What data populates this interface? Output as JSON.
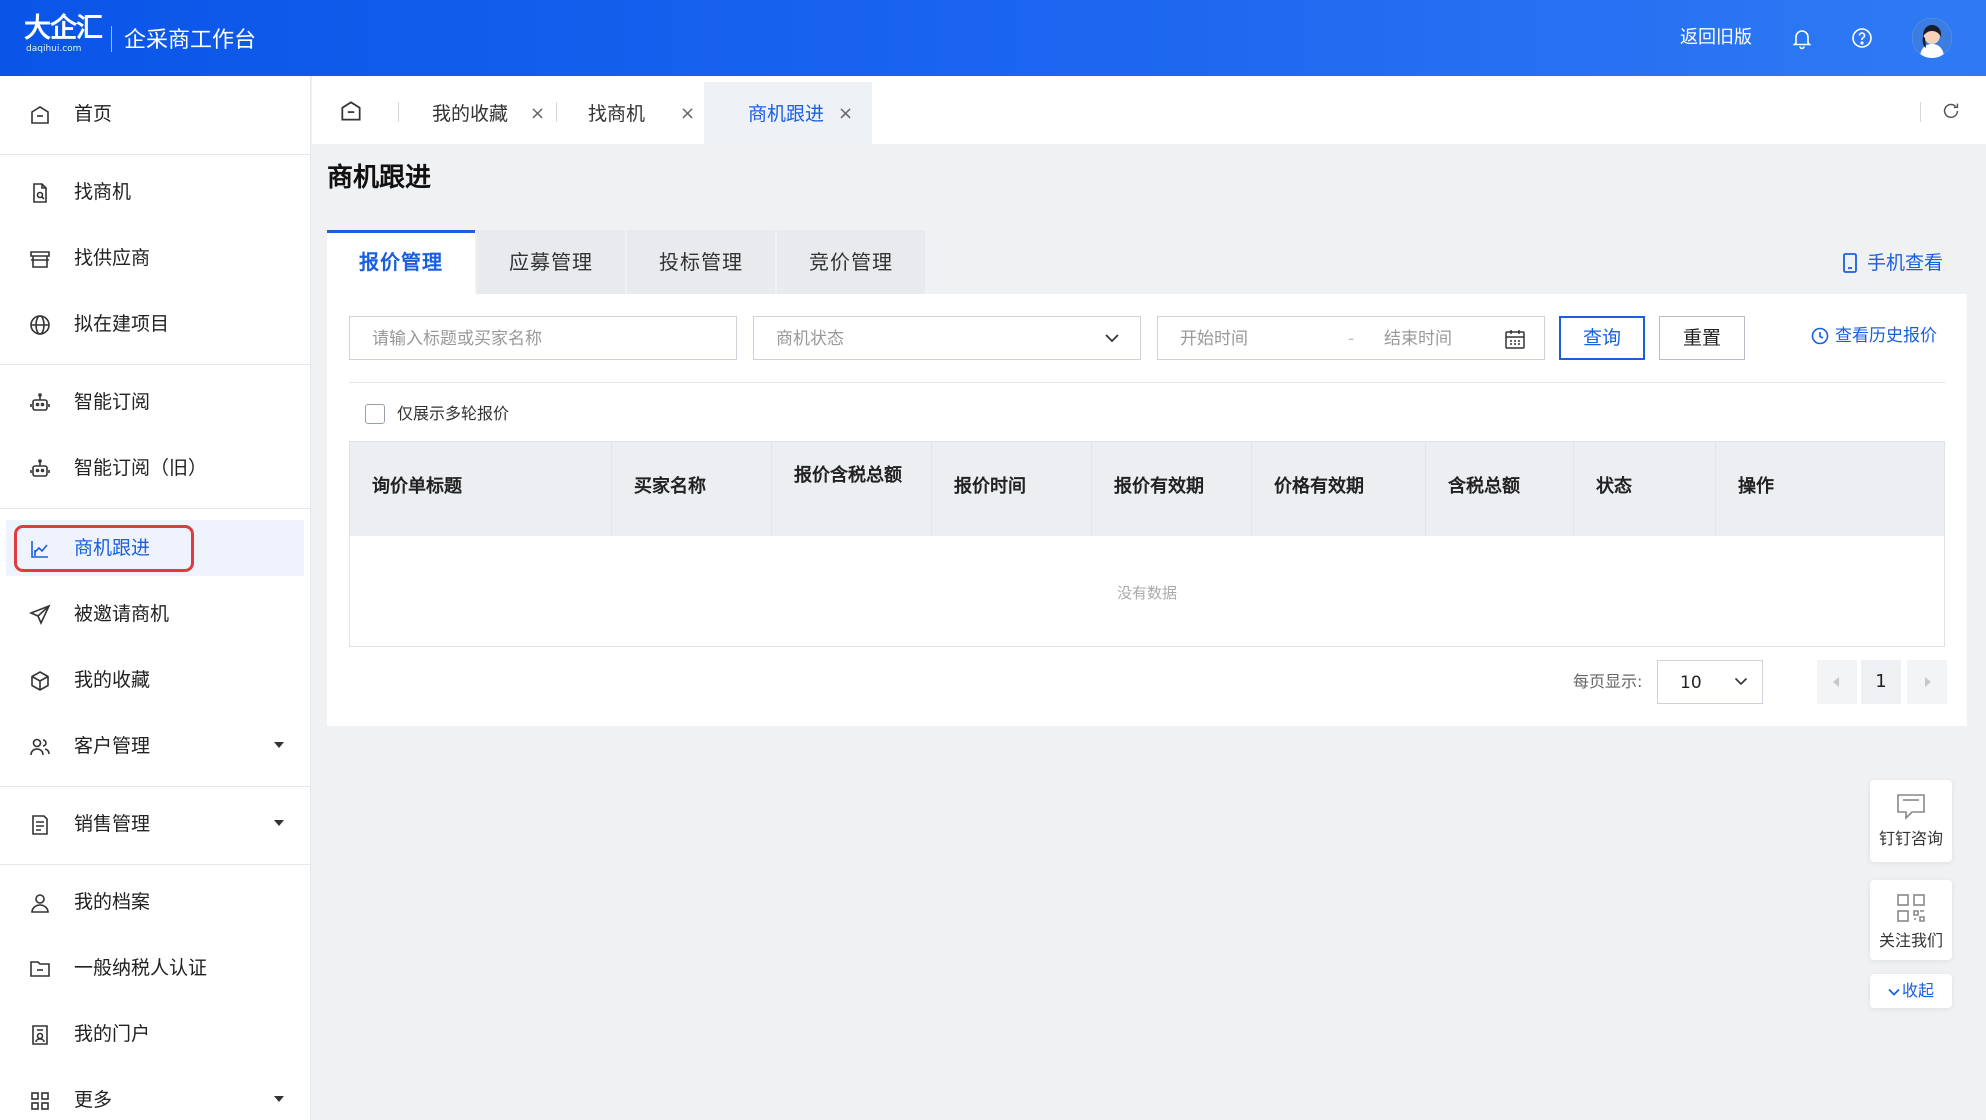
{
  "header": {
    "logo_text": "大企汇",
    "logo_sub": "daqihui.com",
    "title": "企采商工作台",
    "back_old": "返回旧版"
  },
  "sidebar": {
    "items": [
      {
        "label": "首页",
        "icon": "home-icon"
      },
      {
        "label": "找商机",
        "icon": "doc-search-icon"
      },
      {
        "label": "找供应商",
        "icon": "store-icon"
      },
      {
        "label": "拟在建项目",
        "icon": "globe-icon"
      },
      {
        "label": "智能订阅",
        "icon": "robot-icon"
      },
      {
        "label": "智能订阅（旧）",
        "icon": "robot-icon"
      },
      {
        "label": "商机跟进",
        "icon": "chart-icon",
        "active": true
      },
      {
        "label": "被邀请商机",
        "icon": "send-icon"
      },
      {
        "label": "我的收藏",
        "icon": "box-icon"
      },
      {
        "label": "客户管理",
        "icon": "users-icon",
        "expandable": true
      },
      {
        "label": "销售管理",
        "icon": "list-icon",
        "expandable": true
      },
      {
        "label": "我的档案",
        "icon": "user-icon"
      },
      {
        "label": "一般纳税人认证",
        "icon": "folder-icon"
      },
      {
        "label": "我的门户",
        "icon": "portal-icon"
      },
      {
        "label": "更多",
        "icon": "grid-icon",
        "expandable": true
      }
    ]
  },
  "tabs": [
    {
      "label": "我的收藏",
      "close": "×"
    },
    {
      "label": "找商机",
      "close": "×"
    },
    {
      "label": "商机跟进",
      "close": "×",
      "active": true
    }
  ],
  "page": {
    "title": "商机跟进",
    "mobile_view": "手机查看",
    "sub_tabs": [
      "报价管理",
      "应募管理",
      "投标管理",
      "竞价管理"
    ],
    "filters": {
      "keyword_placeholder": "请输入标题或买家名称",
      "status_placeholder": "商机状态",
      "start_placeholder": "开始时间",
      "range_sep": "-",
      "end_placeholder": "结束时间",
      "query": "查询",
      "reset": "重置",
      "history": "查看历史报价"
    },
    "multi_round_label": "仅展示多轮报价",
    "table": {
      "columns": [
        "询价单标题",
        "买家名称",
        "报价含税总额",
        "报价时间",
        "报价有效期",
        "价格有效期",
        "含税总额",
        "状态",
        "操作"
      ],
      "empty": "没有数据"
    },
    "pagination": {
      "per_page_label": "每页显示:",
      "page_size": "10",
      "current_page": "1"
    }
  },
  "float": {
    "dingtalk": "钉钉咨询",
    "follow": "关注我们",
    "collapse": "收起"
  },
  "colors": {
    "primary": "#1a5fe0",
    "header_gradient_start": "#0a55e8",
    "header_gradient_end": "#2f7af4",
    "highlight": "#e23b3b"
  }
}
